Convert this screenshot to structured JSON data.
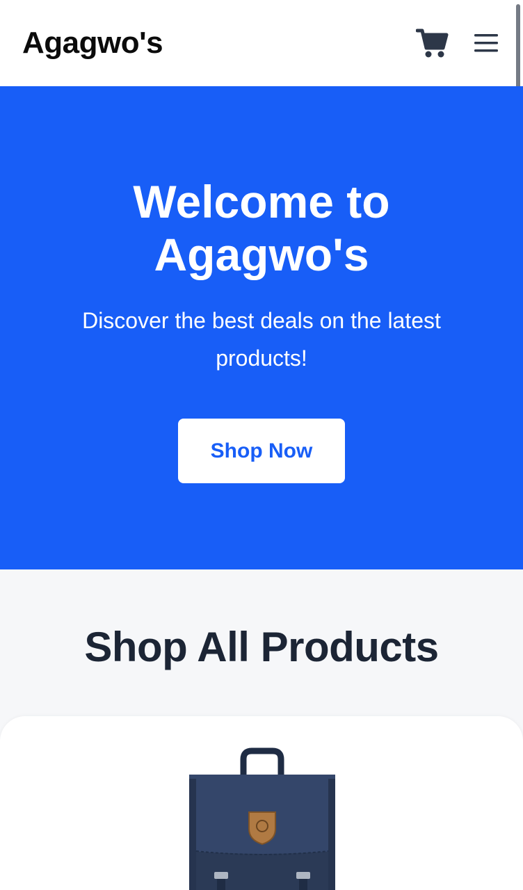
{
  "header": {
    "brand": "Agagwo's",
    "icons": {
      "cart": "shopping-cart-icon",
      "menu": "hamburger-menu-icon"
    }
  },
  "hero": {
    "title": "Welcome to Agagwo's",
    "subtitle": "Discover the best deals on the latest products!",
    "cta_label": "Shop Now"
  },
  "products": {
    "section_title": "Shop All Products",
    "items": [
      {
        "image": "navy-backpack"
      }
    ]
  },
  "colors": {
    "primary": "#185ef7",
    "heading": "#1c2535",
    "background": "#f6f7f9",
    "icon": "#2d3748"
  }
}
